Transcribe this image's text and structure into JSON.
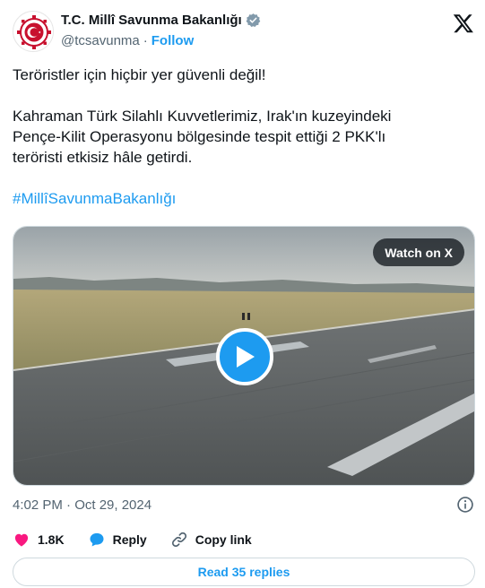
{
  "author": {
    "display_name": "T.C. Millî Savunma Bakanlığı",
    "handle": "@tcsavunma",
    "separator": "·",
    "follow_label": "Follow",
    "verified": true,
    "badge_color": "#829aab"
  },
  "tweet": {
    "line1": "Teröristler için hiçbir yer güvenli değil!",
    "line2": "Kahraman Türk Silahlı Kuvvetlerimiz, Irak'ın kuzeyindeki",
    "line3": "Pençe-Kilit Operasyonu bölgesinde tespit ettiği 2 PKK'lı",
    "line4": "teröristi etkisiz hâle getirdi.",
    "hashtag": "#MillîSavunmaBakanlığı"
  },
  "media": {
    "watch_label": "Watch on X",
    "type": "video"
  },
  "meta": {
    "timestamp": "4:02 PM · Oct 29, 2024"
  },
  "actions": {
    "likes": "1.8K",
    "reply_label": "Reply",
    "copy_link_label": "Copy link"
  },
  "footer": {
    "read_replies_label": "Read 35 replies"
  },
  "colors": {
    "accent": "#1d9bf0",
    "like": "#f91880",
    "text": "#0f1419",
    "muted": "#536471"
  }
}
